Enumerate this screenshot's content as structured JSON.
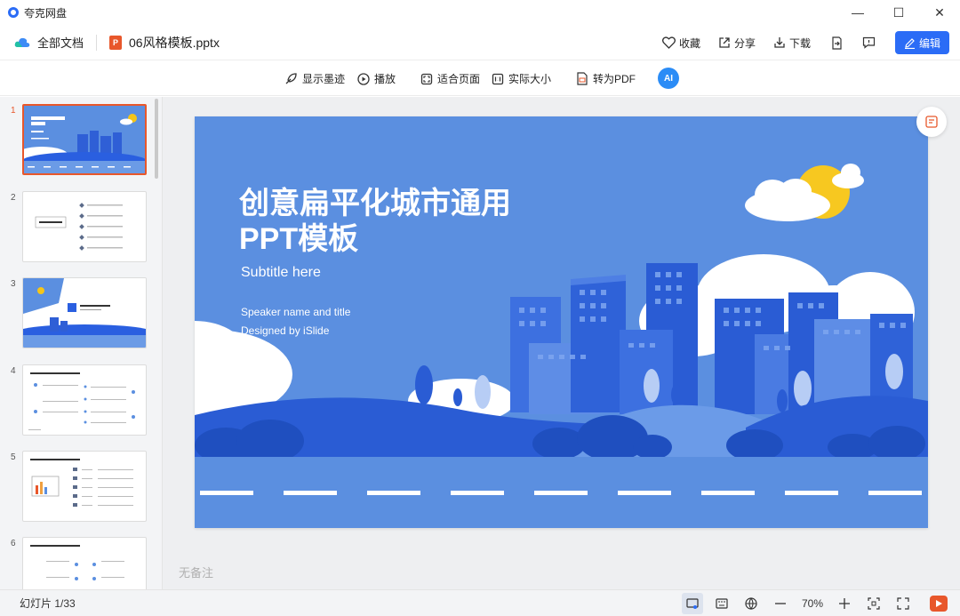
{
  "app": {
    "title": "夸克网盘"
  },
  "window": {
    "minimize": "—",
    "maximize": "☐",
    "close": "✕"
  },
  "docbar": {
    "all_docs": "全部文档",
    "file_badge": "P",
    "filename": "06风格模板.pptx",
    "favorite": "收藏",
    "share": "分享",
    "download": "下载",
    "edit": "编辑"
  },
  "toolbar": {
    "show_ink": "显示墨迹",
    "play": "播放",
    "fit_page": "适合页面",
    "actual_size": "实际大小",
    "to_pdf": "转为PDF",
    "ai": "AI"
  },
  "thumbnails": [
    {
      "num": "1",
      "active": true
    },
    {
      "num": "2",
      "active": false
    },
    {
      "num": "3",
      "active": false
    },
    {
      "num": "4",
      "active": false
    },
    {
      "num": "5",
      "active": false
    },
    {
      "num": "6",
      "active": false
    }
  ],
  "slide": {
    "title_line1": "创意扁平化城市通用",
    "title_line2": "PPT模板",
    "subtitle": "Subtitle here",
    "speaker": "Speaker name and title",
    "designed": "Designed by iSlide"
  },
  "notes_placeholder": "无备注",
  "status": {
    "slide_count": "幻灯片 1/33",
    "zoom": "70%"
  },
  "colors": {
    "accent": "#2b6cf6",
    "ppt": "#e8572b",
    "slide_bg": "#5b8fe0"
  }
}
